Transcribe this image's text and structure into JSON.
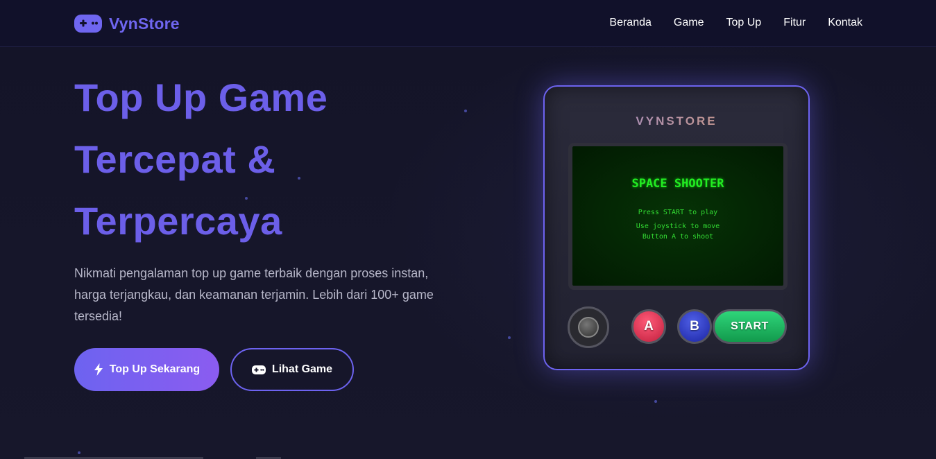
{
  "brand": {
    "name": "VynStore",
    "icon": "gamepad-icon"
  },
  "nav": {
    "items": [
      {
        "label": "Beranda"
      },
      {
        "label": "Game"
      },
      {
        "label": "Top Up"
      },
      {
        "label": "Fitur"
      },
      {
        "label": "Kontak"
      }
    ]
  },
  "hero": {
    "title_line1": "Top Up Game",
    "title_line2": "Tercepat &",
    "title_line3": "Terpercaya",
    "description": "Nikmati pengalaman top up game terbaik dengan proses instan, harga terjangkau, dan keamanan terjamin. Lebih dari 100+ game tersedia!",
    "primary_button": {
      "label": "Top Up Sekarang",
      "icon": "bolt-icon"
    },
    "secondary_button": {
      "label": "Lihat Game",
      "icon": "gamepad-icon"
    }
  },
  "console": {
    "brand": "VYNSTORE",
    "screen": {
      "title": "SPACE SHOOTER",
      "line1": "Press START to play",
      "line2": "Use joystick to move",
      "line3": "Button A to shoot"
    },
    "button_a": "A",
    "button_b": "B",
    "button_start": "START"
  },
  "colors": {
    "accent": "#6d63f0",
    "background": "#15152a",
    "header": "#11112a",
    "screen_text": "#22ee22",
    "start_button": "#1fb862",
    "a_button": "#e0405e",
    "b_button": "#3a45c8"
  }
}
